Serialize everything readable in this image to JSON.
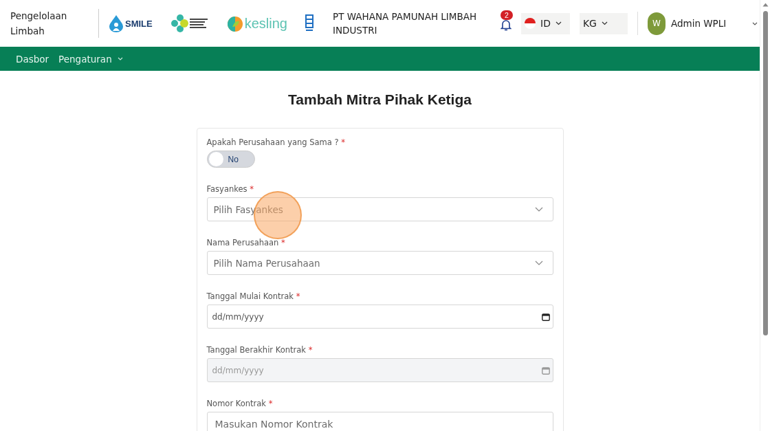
{
  "header": {
    "app_name": "Pengelolaan Limbah",
    "logos": [
      {
        "kind": "smile",
        "text": "SMILE"
      },
      {
        "kind": "kemenkes"
      },
      {
        "kind": "kesling",
        "text": "kesling"
      },
      {
        "kind": "undp"
      }
    ],
    "company": "PT WAHANA PAMUNAH LIMBAH INDUSTRI",
    "notifications": {
      "count": "2"
    },
    "language": {
      "label": "ID"
    },
    "unit": {
      "label": "KG"
    },
    "user": {
      "initial": "W",
      "name": "Admin WPLI"
    }
  },
  "nav": [
    {
      "label": "Dasbor",
      "dropdown": false
    },
    {
      "label": "Pengaturan",
      "dropdown": true
    }
  ],
  "page_title": "Tambah Mitra Pihak Ketiga",
  "form": [
    {
      "kind": "toggle",
      "label": "Apakah Perusahaan yang Sama ?",
      "required": true,
      "on": false,
      "text": "No"
    },
    {
      "kind": "select",
      "label": "Fasyankes",
      "required": true,
      "placeholder": "Pilih Fasyankes"
    },
    {
      "kind": "select",
      "label": "Nama Perusahaan",
      "required": true,
      "placeholder": "Pilih Nama Perusahaan"
    },
    {
      "kind": "date",
      "label": "Tanggal Mulai Kontrak",
      "required": true,
      "placeholder": "dd/mm/yyyy",
      "disabled": false
    },
    {
      "kind": "date",
      "label": "Tanggal Berakhir Kontrak",
      "required": true,
      "placeholder": "dd/mm/yyyy",
      "disabled": true
    },
    {
      "kind": "text",
      "label": "Nomor Kontrak",
      "required": true,
      "placeholder": "Masukan Nomor Kontrak"
    }
  ],
  "asterisk": "*"
}
